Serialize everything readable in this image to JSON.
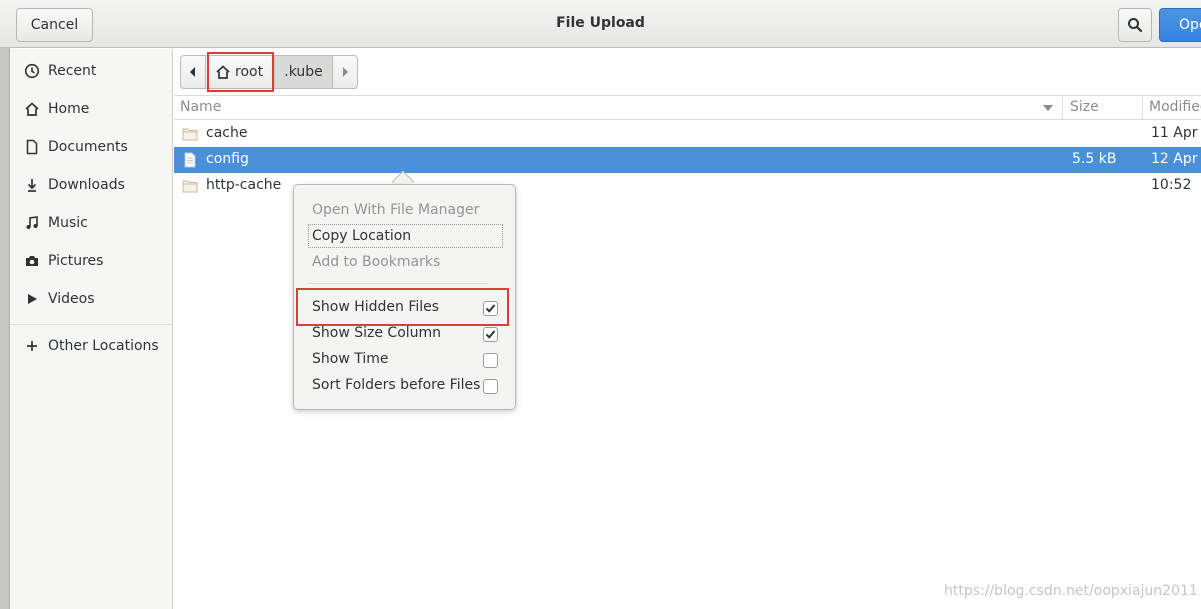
{
  "header": {
    "cancel_label": "Cancel",
    "title": "File Upload",
    "open_label": "Open"
  },
  "sidebar": {
    "items": [
      {
        "label": "Recent",
        "icon": "clock-icon"
      },
      {
        "label": "Home",
        "icon": "home-icon"
      },
      {
        "label": "Documents",
        "icon": "document-icon"
      },
      {
        "label": "Downloads",
        "icon": "download-icon"
      },
      {
        "label": "Music",
        "icon": "music-icon"
      },
      {
        "label": "Pictures",
        "icon": "camera-icon"
      },
      {
        "label": "Videos",
        "icon": "video-icon"
      },
      {
        "label": "Other Locations",
        "icon": "plus-icon"
      }
    ]
  },
  "pathbar": {
    "root_label": "root",
    "kube_label": ".kube"
  },
  "columns": {
    "name": "Name",
    "size": "Size",
    "modified": "Modified"
  },
  "files": [
    {
      "name": "cache",
      "type": "folder",
      "size": "",
      "modified": "11 Apr"
    },
    {
      "name": "config",
      "type": "file",
      "size": "5.5 kB",
      "modified": "12 Apr",
      "selected": true
    },
    {
      "name": "http-cache",
      "type": "folder",
      "size": "",
      "modified": "10:52"
    }
  ],
  "menu": {
    "open_with": "Open With File Manager",
    "copy_location": "Copy Location",
    "add_bookmarks": "Add to Bookmarks",
    "show_hidden": "Show Hidden Files",
    "show_hidden_checked": true,
    "show_size": "Show Size Column",
    "show_size_checked": true,
    "show_time": "Show Time",
    "show_time_checked": false,
    "sort_folders": "Sort Folders before Files",
    "sort_folders_checked": false
  },
  "colors": {
    "selection": "#4a90d9",
    "highlight_box": "#e03b3b",
    "suggested_action": "#3584e4"
  },
  "watermark": "https://blog.csdn.net/oopxiajun2011"
}
